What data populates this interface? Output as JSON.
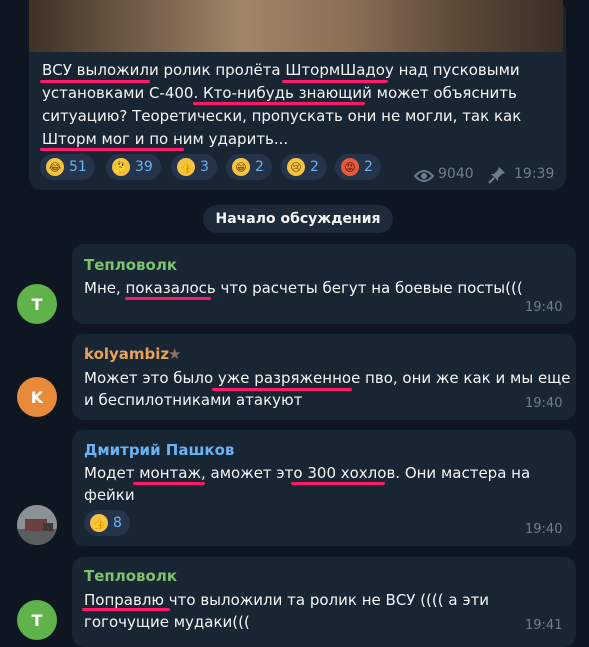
{
  "post": {
    "lines": [
      "ВСУ выложили ролик пролёта ШтормШадоу над пусковыми",
      "установками С-400. Кто-нибудь знающий может объяснить",
      "ситуацию? Теоретически, пропускать они не могли, так как",
      "Шторм мог и по ним ударить..."
    ],
    "reactions": [
      {
        "emoji": "laugh",
        "glyph": "😂",
        "count": "51"
      },
      {
        "emoji": "thinking",
        "glyph": "🤔",
        "count": "39"
      },
      {
        "emoji": "thumbs-up",
        "glyph": "👍",
        "count": "3"
      },
      {
        "emoji": "grin",
        "glyph": "😁",
        "count": "2"
      },
      {
        "emoji": "cry",
        "glyph": "😢",
        "count": "2"
      },
      {
        "emoji": "angry",
        "glyph": "😡",
        "count": "2"
      }
    ],
    "views": "9040",
    "time": "19:39"
  },
  "discussion_label": "Начало обсуждения",
  "comments": [
    {
      "author": "Тепловолк",
      "author_color": "#7ec16e",
      "avatar_letter": "Т",
      "avatar_color": "#5fb34a",
      "lines": [
        "Мне, показалось что расчеты бегут на боевые посты((("
      ],
      "time": "19:40"
    },
    {
      "author": "kolyambiz",
      "author_color": "#e8a25a",
      "avatar_letter": "K",
      "avatar_color": "#e88a3a",
      "lines": [
        "Может это было уже разряженное пво, они же как и мы еще",
        "и беспилотниками атакуют"
      ],
      "time": "19:40"
    },
    {
      "author": "Дмитрий Пашков",
      "author_color": "#6ab2f2",
      "avatar_letter": "",
      "avatar_color": "#6b6f73",
      "lines": [
        "Модет монтаж, аможет это 300 хохлов. Они мастера на",
        "фейки"
      ],
      "reaction": {
        "emoji": "thumbs-up",
        "glyph": "👍",
        "count": "8"
      },
      "time": "19:40"
    },
    {
      "author": "Тепловолк",
      "author_color": "#7ec16e",
      "avatar_letter": "Т",
      "avatar_color": "#5fb34a",
      "lines": [
        "Поправлю что выложили та ролик не ВСУ (((( а эти",
        "гогочущие мудаки((("
      ],
      "time": "19:41"
    }
  ],
  "colors": {
    "underline": "#ff1a6c",
    "link": "#6ab2f2",
    "bubble": "#182533",
    "background": "#0e1621"
  }
}
